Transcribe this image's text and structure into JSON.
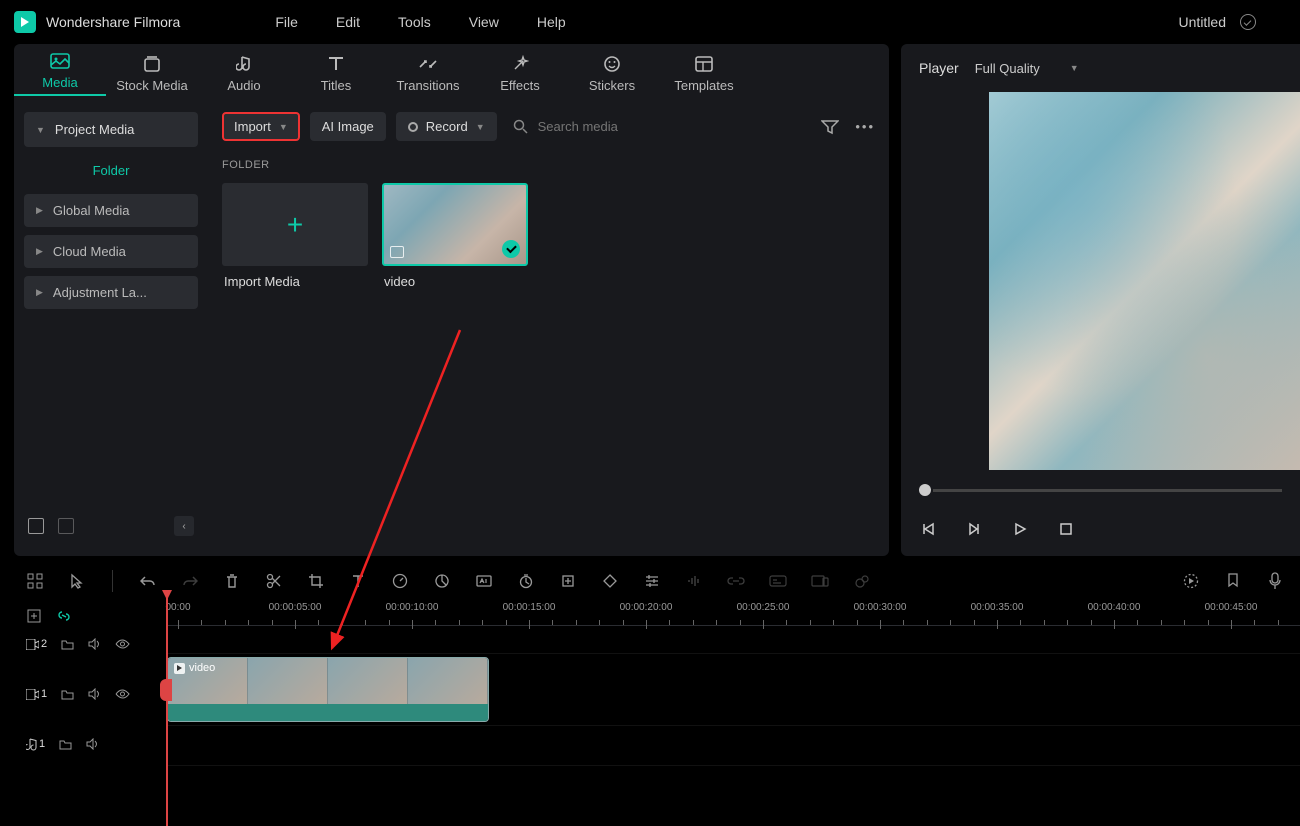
{
  "app": {
    "name": "Wondershare Filmora",
    "document": "Untitled"
  },
  "menu": [
    "File",
    "Edit",
    "Tools",
    "View",
    "Help"
  ],
  "tabs": [
    {
      "label": "Media",
      "active": true
    },
    {
      "label": "Stock Media"
    },
    {
      "label": "Audio"
    },
    {
      "label": "Titles"
    },
    {
      "label": "Transitions"
    },
    {
      "label": "Effects"
    },
    {
      "label": "Stickers"
    },
    {
      "label": "Templates"
    }
  ],
  "sidebar": {
    "project_media": "Project Media",
    "folder": "Folder",
    "global_media": "Global Media",
    "cloud_media": "Cloud Media",
    "adjustment": "Adjustment La..."
  },
  "toolbar": {
    "import": "Import",
    "ai_image": "AI Image",
    "record": "Record",
    "search_placeholder": "Search media"
  },
  "content": {
    "folder_label": "FOLDER",
    "import_media": "Import Media",
    "clip_name": "video"
  },
  "player": {
    "title": "Player",
    "quality": "Full Quality"
  },
  "timeline": {
    "clip_name": "video",
    "track_video_2": "2",
    "track_video_1": "1",
    "track_audio_1": "1",
    "timecodes": [
      "00:00",
      "00:00:05:00",
      "00:00:10:00",
      "00:00:15:00",
      "00:00:20:00",
      "00:00:25:00",
      "00:00:30:00",
      "00:00:35:00",
      "00:00:40:00",
      "00:00:45:00"
    ]
  }
}
